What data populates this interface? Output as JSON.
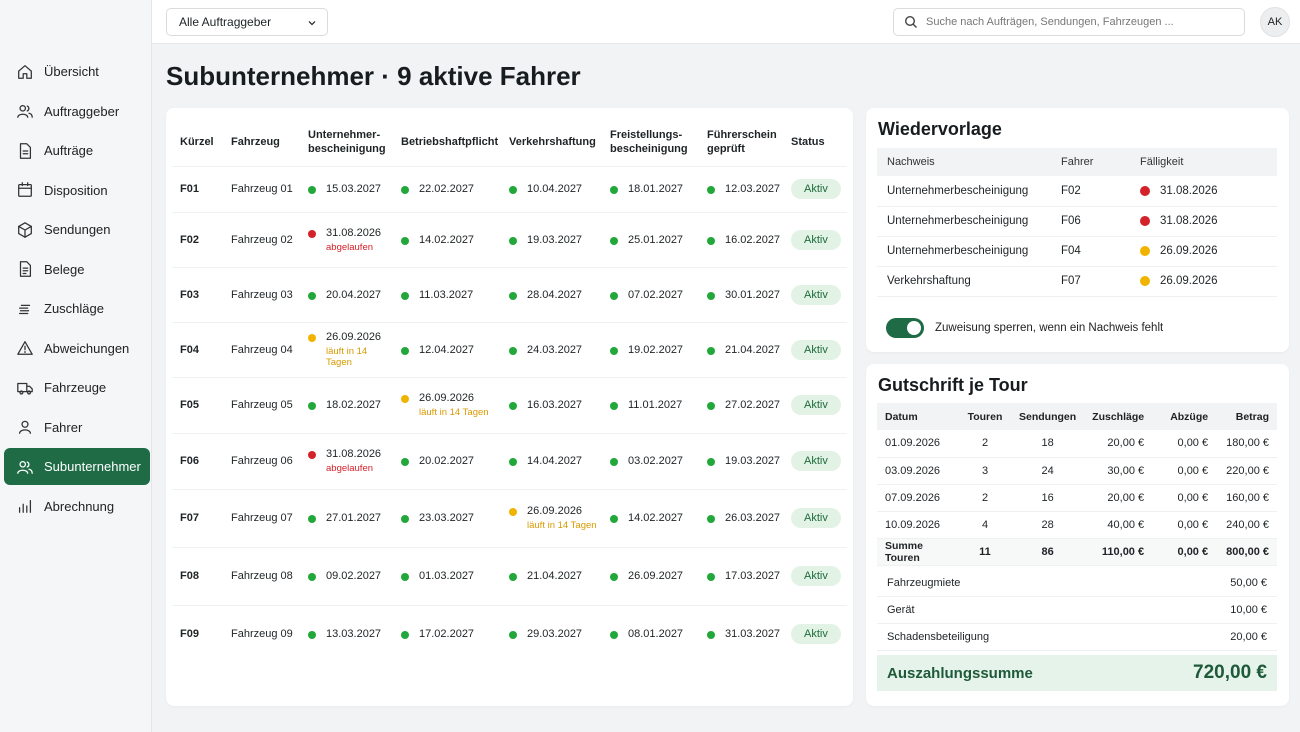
{
  "colors": {
    "accent": "#1e6b46",
    "ok": "#22a83a",
    "warn": "#f0b400",
    "bad": "#d3222a"
  },
  "topbar": {
    "client_select": "Alle Auftraggeber",
    "search_placeholder": "Suche nach Aufträgen, Sendungen, Fahrzeugen ...",
    "avatar": "AK"
  },
  "sidebar": {
    "items": [
      {
        "label": "Übersicht",
        "icon": "home-icon"
      },
      {
        "label": "Auftraggeber",
        "icon": "users-icon"
      },
      {
        "label": "Aufträge",
        "icon": "document-icon"
      },
      {
        "label": "Disposition",
        "icon": "calendar-icon"
      },
      {
        "label": "Sendungen",
        "icon": "package-icon"
      },
      {
        "label": "Belege",
        "icon": "receipt-icon"
      },
      {
        "label": "Zuschläge",
        "icon": "coins-icon"
      },
      {
        "label": "Abweichungen",
        "icon": "warning-icon"
      },
      {
        "label": "Fahrzeuge",
        "icon": "truck-icon"
      },
      {
        "label": "Fahrer",
        "icon": "user-icon"
      },
      {
        "label": "Subunternehmer",
        "icon": "users-icon",
        "active": true
      },
      {
        "label": "Abrechnung",
        "icon": "bar-chart-icon"
      }
    ]
  },
  "page": {
    "title": "Subunternehmer · 9 aktive Fahrer"
  },
  "main_table": {
    "headers": [
      "Kürzel",
      "Fahrzeug",
      "Unternehmer-\nbescheinigung",
      "Betriebshaftpflicht",
      "Verkehrshaftung",
      "Freistellungs-\nbescheinigung",
      "Führerschein\ngeprüft",
      "Status"
    ],
    "rows": [
      {
        "code": "F01",
        "vehicle": "Fahrzeug 01",
        "dates": [
          {
            "d": "15.03.2027",
            "s": "ok"
          },
          {
            "d": "22.02.2027",
            "s": "ok"
          },
          {
            "d": "10.04.2027",
            "s": "ok"
          },
          {
            "d": "18.01.2027",
            "s": "ok"
          },
          {
            "d": "12.03.2027",
            "s": "ok"
          }
        ],
        "status": "Aktiv"
      },
      {
        "code": "F02",
        "vehicle": "Fahrzeug 02",
        "dates": [
          {
            "d": "31.08.2026",
            "s": "bad",
            "note": "abgelaufen"
          },
          {
            "d": "14.02.2027",
            "s": "ok"
          },
          {
            "d": "19.03.2027",
            "s": "ok"
          },
          {
            "d": "25.01.2027",
            "s": "ok"
          },
          {
            "d": "16.02.2027",
            "s": "ok"
          }
        ],
        "status": "Aktiv"
      },
      {
        "code": "F03",
        "vehicle": "Fahrzeug 03",
        "dates": [
          {
            "d": "20.04.2027",
            "s": "ok"
          },
          {
            "d": "11.03.2027",
            "s": "ok"
          },
          {
            "d": "28.04.2027",
            "s": "ok"
          },
          {
            "d": "07.02.2027",
            "s": "ok"
          },
          {
            "d": "30.01.2027",
            "s": "ok"
          }
        ],
        "status": "Aktiv"
      },
      {
        "code": "F04",
        "vehicle": "Fahrzeug 04",
        "dates": [
          {
            "d": "26.09.2026",
            "s": "warn",
            "note": "läuft in 14 Tagen"
          },
          {
            "d": "12.04.2027",
            "s": "ok"
          },
          {
            "d": "24.03.2027",
            "s": "ok"
          },
          {
            "d": "19.02.2027",
            "s": "ok"
          },
          {
            "d": "21.04.2027",
            "s": "ok"
          }
        ],
        "status": "Aktiv"
      },
      {
        "code": "F05",
        "vehicle": "Fahrzeug 05",
        "dates": [
          {
            "d": "18.02.2027",
            "s": "ok"
          },
          {
            "d": "26.09.2026",
            "s": "warn",
            "note": "läuft in 14 Tagen"
          },
          {
            "d": "16.03.2027",
            "s": "ok"
          },
          {
            "d": "11.01.2027",
            "s": "ok"
          },
          {
            "d": "27.02.2027",
            "s": "ok"
          }
        ],
        "status": "Aktiv"
      },
      {
        "code": "F06",
        "vehicle": "Fahrzeug 06",
        "dates": [
          {
            "d": "31.08.2026",
            "s": "bad",
            "note": "abgelaufen"
          },
          {
            "d": "20.02.2027",
            "s": "ok"
          },
          {
            "d": "14.04.2027",
            "s": "ok"
          },
          {
            "d": "03.02.2027",
            "s": "ok"
          },
          {
            "d": "19.03.2027",
            "s": "ok"
          }
        ],
        "status": "Aktiv"
      },
      {
        "code": "F07",
        "vehicle": "Fahrzeug 07",
        "dates": [
          {
            "d": "27.01.2027",
            "s": "ok"
          },
          {
            "d": "23.03.2027",
            "s": "ok"
          },
          {
            "d": "26.09.2026",
            "s": "warn",
            "note": "läuft in 14 Tagen"
          },
          {
            "d": "14.02.2027",
            "s": "ok"
          },
          {
            "d": "26.03.2027",
            "s": "ok"
          }
        ],
        "status": "Aktiv"
      },
      {
        "code": "F08",
        "vehicle": "Fahrzeug 08",
        "dates": [
          {
            "d": "09.02.2027",
            "s": "ok"
          },
          {
            "d": "01.03.2027",
            "s": "ok"
          },
          {
            "d": "21.04.2027",
            "s": "ok"
          },
          {
            "d": "26.09.2027",
            "s": "ok"
          },
          {
            "d": "17.03.2027",
            "s": "ok"
          }
        ],
        "status": "Aktiv"
      },
      {
        "code": "F09",
        "vehicle": "Fahrzeug 09",
        "dates": [
          {
            "d": "13.03.2027",
            "s": "ok"
          },
          {
            "d": "17.02.2027",
            "s": "ok"
          },
          {
            "d": "29.03.2027",
            "s": "ok"
          },
          {
            "d": "08.01.2027",
            "s": "ok"
          },
          {
            "d": "31.03.2027",
            "s": "ok"
          }
        ],
        "status": "Aktiv"
      }
    ]
  },
  "wiedervorlage": {
    "title": "Wiedervorlage",
    "headers": [
      "Nachweis",
      "Fahrer",
      "Fälligkeit"
    ],
    "rows": [
      {
        "doc": "Unternehmerbescheinigung",
        "driver": "F02",
        "due": "31.08.2026",
        "s": "bad"
      },
      {
        "doc": "Unternehmerbescheinigung",
        "driver": "F06",
        "due": "31.08.2026",
        "s": "bad"
      },
      {
        "doc": "Unternehmerbescheinigung",
        "driver": "F04",
        "due": "26.09.2026",
        "s": "warn"
      },
      {
        "doc": "Verkehrshaftung",
        "driver": "F07",
        "due": "26.09.2026",
        "s": "warn"
      }
    ],
    "toggle_label": "Zuweisung sperren, wenn ein Nachweis fehlt",
    "toggle_on": true
  },
  "gutschrift": {
    "title": "Gutschrift je Tour",
    "headers": [
      "Datum",
      "Touren",
      "Sendungen",
      "Zuschläge",
      "Abzüge",
      "Betrag"
    ],
    "rows": [
      [
        "01.09.2026",
        "2",
        "18",
        "20,00 €",
        "0,00 €",
        "180,00 €"
      ],
      [
        "03.09.2026",
        "3",
        "24",
        "30,00 €",
        "0,00 €",
        "220,00 €"
      ],
      [
        "07.09.2026",
        "2",
        "16",
        "20,00 €",
        "0,00 €",
        "160,00 €"
      ],
      [
        "10.09.2026",
        "4",
        "28",
        "40,00 €",
        "0,00 €",
        "240,00 €"
      ]
    ],
    "sum": [
      "Summe Touren",
      "11",
      "86",
      "110,00 €",
      "0,00 €",
      "800,00 €"
    ],
    "extras": [
      {
        "label": "Fahrzeugmiete",
        "value": "50,00 €"
      },
      {
        "label": "Gerät",
        "value": "10,00 €"
      },
      {
        "label": "Schadensbeteiligung",
        "value": "20,00 €"
      }
    ],
    "payout_label": "Auszahlungssumme",
    "payout_value": "720,00 €"
  }
}
